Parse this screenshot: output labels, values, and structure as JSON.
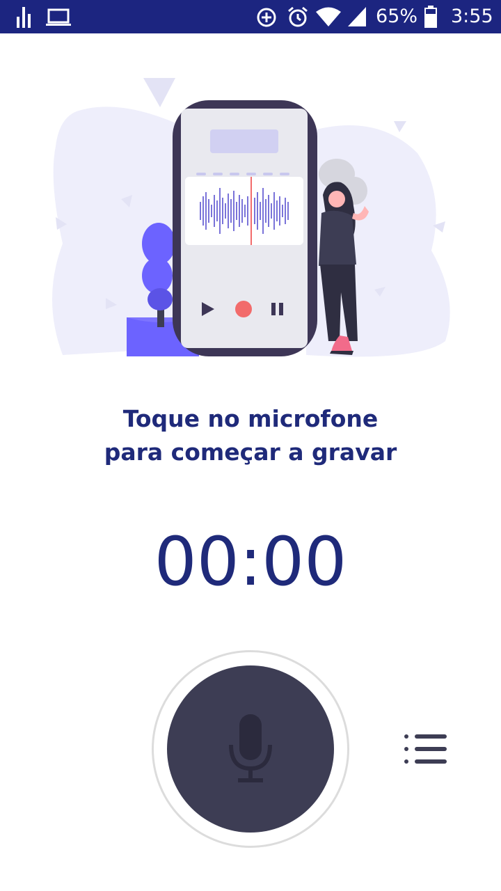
{
  "status_bar": {
    "battery_percent": "65%",
    "time": "3:55",
    "icons": [
      "signal-bars-icon",
      "laptop-icon",
      "data-saver-icon",
      "alarm-icon",
      "wifi-icon",
      "cell-signal-icon",
      "battery-icon"
    ]
  },
  "main": {
    "prompt_line1": "Toque no microfone",
    "prompt_line2": "para começar a gravar",
    "timer": "00:00"
  },
  "controls": {
    "record_icon": "microphone-icon",
    "list_icon": "list-icon"
  },
  "colors": {
    "status_bar": "#1c2580",
    "text_primary": "#1f2a7a",
    "record_button": "#3d3d54",
    "illustration_accent": "#6c63ff",
    "recording_dot": "#f26b6b"
  }
}
